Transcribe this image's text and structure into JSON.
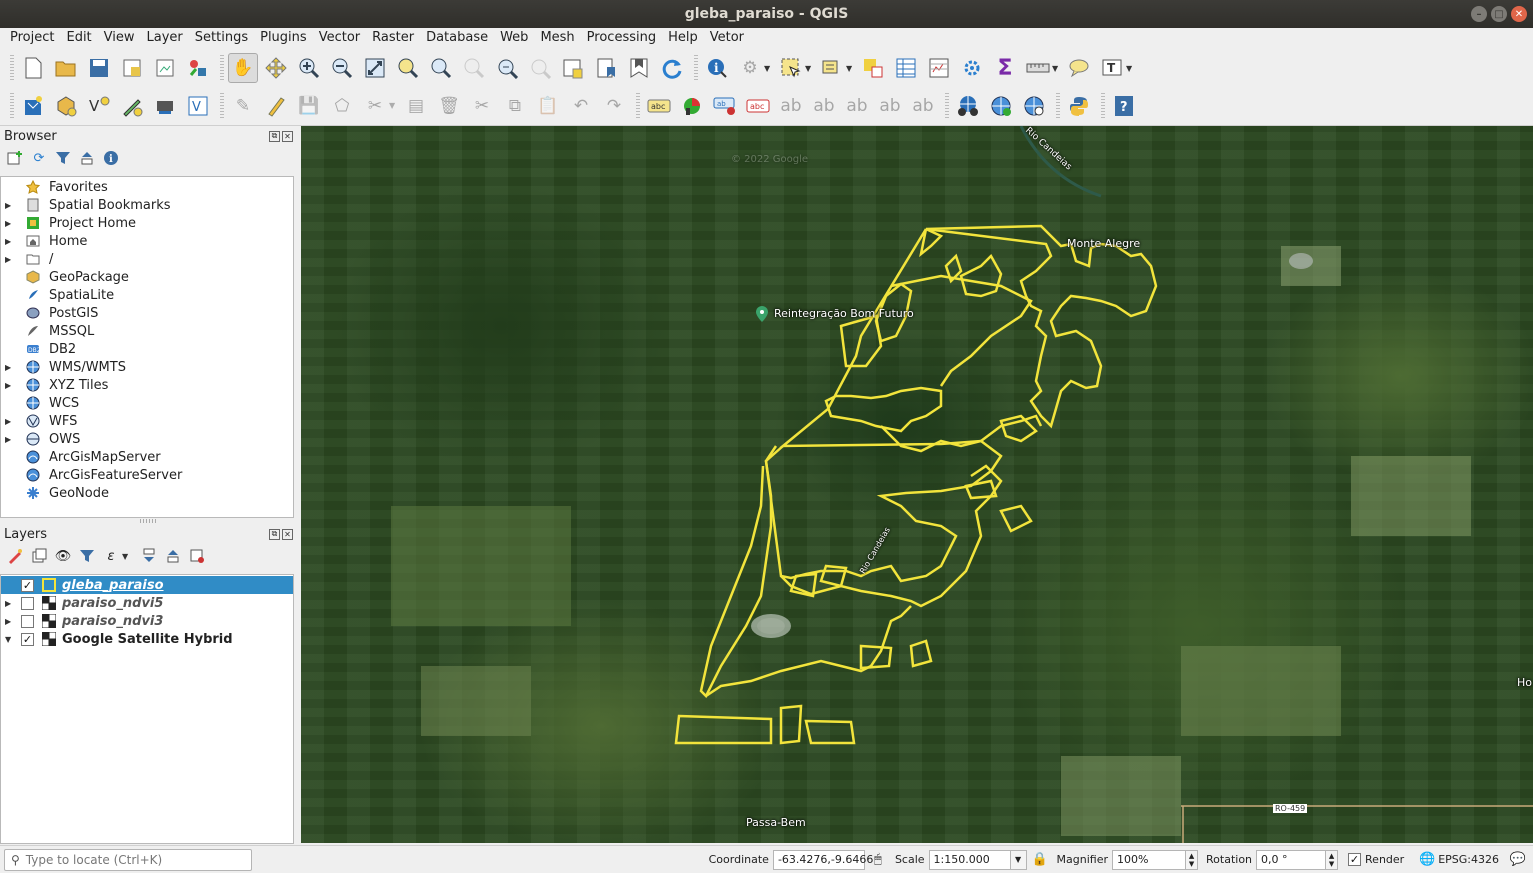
{
  "window": {
    "title": "gleba_paraiso - QGIS"
  },
  "menu": [
    "Project",
    "Edit",
    "View",
    "Layer",
    "Settings",
    "Plugins",
    "Vector",
    "Raster",
    "Database",
    "Web",
    "Mesh",
    "Processing",
    "Help",
    "Vetor"
  ],
  "browser": {
    "title": "Browser",
    "items": [
      {
        "label": "Favorites",
        "icon": "star-icon",
        "expand": false
      },
      {
        "label": "Spatial Bookmarks",
        "icon": "bookmark-icon",
        "expand": true
      },
      {
        "label": "Project Home",
        "icon": "project-home-icon",
        "expand": true
      },
      {
        "label": "Home",
        "icon": "home-folder-icon",
        "expand": true
      },
      {
        "label": "/",
        "icon": "folder-icon",
        "expand": true
      },
      {
        "label": "GeoPackage",
        "icon": "geopackage-icon",
        "expand": false
      },
      {
        "label": "SpatiaLite",
        "icon": "spatialite-icon",
        "expand": false
      },
      {
        "label": "PostGIS",
        "icon": "postgis-icon",
        "expand": false
      },
      {
        "label": "MSSQL",
        "icon": "mssql-icon",
        "expand": false
      },
      {
        "label": "DB2",
        "icon": "db2-icon",
        "expand": false
      },
      {
        "label": "WMS/WMTS",
        "icon": "wms-icon",
        "expand": true
      },
      {
        "label": "XYZ Tiles",
        "icon": "xyz-tiles-icon",
        "expand": true
      },
      {
        "label": "WCS",
        "icon": "wcs-icon",
        "expand": false
      },
      {
        "label": "WFS",
        "icon": "wfs-icon",
        "expand": true
      },
      {
        "label": "OWS",
        "icon": "ows-icon",
        "expand": true
      },
      {
        "label": "ArcGisMapServer",
        "icon": "arcgis-map-icon",
        "expand": false
      },
      {
        "label": "ArcGisFeatureServer",
        "icon": "arcgis-feature-icon",
        "expand": false
      },
      {
        "label": "GeoNode",
        "icon": "geonode-icon",
        "expand": false
      }
    ]
  },
  "layers": {
    "title": "Layers",
    "items": [
      {
        "label": "gleba_paraiso",
        "checked": true,
        "selected": true,
        "italic": true
      },
      {
        "label": "paraiso_ndvi5",
        "checked": false,
        "selected": false,
        "italic": true
      },
      {
        "label": "paraiso_ndvi3",
        "checked": false,
        "selected": false,
        "italic": true
      },
      {
        "label": "Google Satellite Hybrid",
        "checked": true,
        "selected": false,
        "italic": false
      }
    ]
  },
  "map": {
    "labels": {
      "rio_candeias": "Rio Candeias",
      "monte_alegre": "Monte Alegre",
      "reintegracao": "Reintegração Bom Futuro",
      "passa_bem": "Passa-Bem",
      "edge_label": "Ho",
      "road_label": "RO-459",
      "rio_small": "Rio Candeias",
      "watermark": "© 2022 Google"
    },
    "polygon_color": "#f2e43c"
  },
  "status": {
    "locate_placeholder": "Type to locate (Ctrl+K)",
    "coordinate_label": "Coordinate",
    "coordinate_value": "-63.4276,-9.6466",
    "scale_label": "Scale",
    "scale_value": "1:150.000",
    "magnifier_label": "Magnifier",
    "magnifier_value": "100%",
    "rotation_label": "Rotation",
    "rotation_value": "0,0 °",
    "render_label": "Render",
    "crs_value": "EPSG:4326"
  }
}
